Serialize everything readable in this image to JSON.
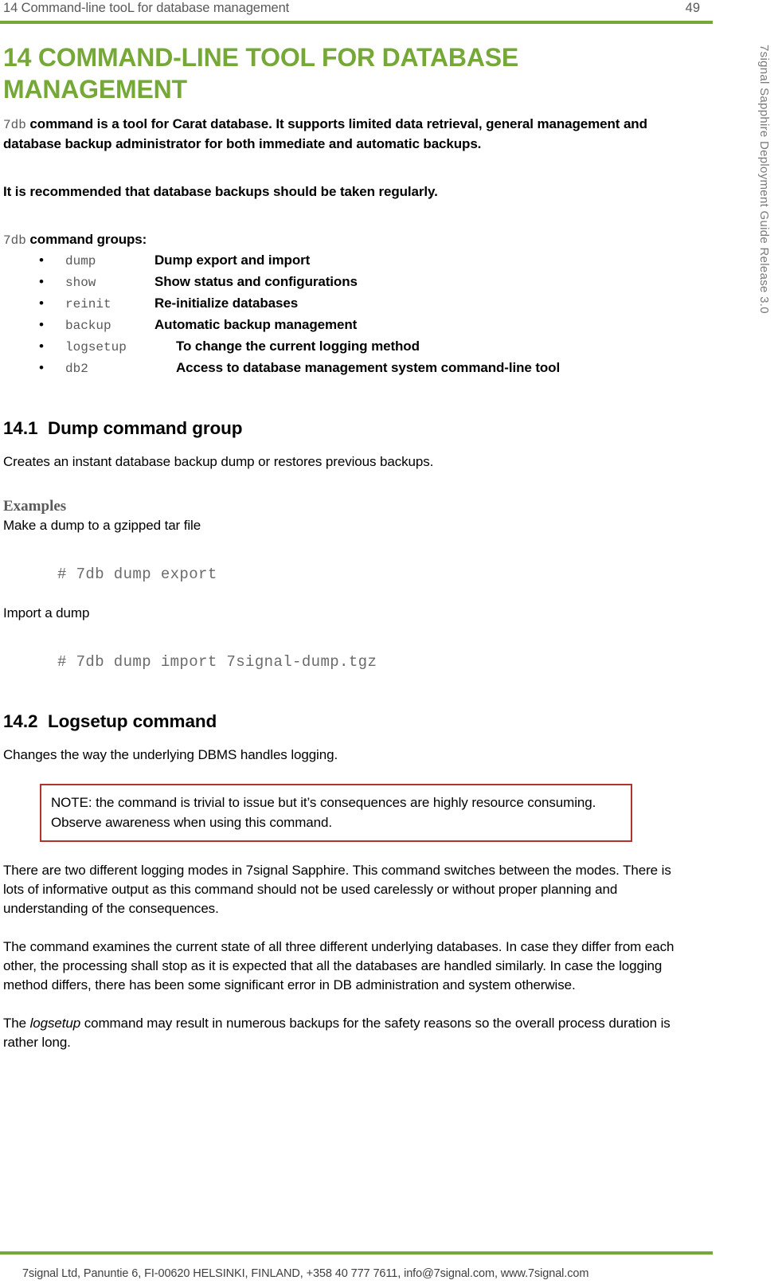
{
  "header": {
    "title": "14 Command-line tooL for database management",
    "page_number": "49"
  },
  "side_title": "7signal Sapphire Deployment Guide Release 3.0",
  "chapter": {
    "heading": "14 COMMAND-LINE TOOL FOR DATABASE MANAGEMENT",
    "intro_cmd": "7db",
    "intro_rest": " command is a tool for Carat database. It supports limited data retrieval, general management and database backup administrator for both immediate and automatic backups.",
    "recommendation": "It is recommended that database backups should be taken regularly.",
    "groups_intro_cmd": "7db",
    "groups_intro_rest": " command groups:"
  },
  "command_groups": [
    {
      "bullet": "•",
      "command": "dump",
      "description": "Dump export and import",
      "indent_desc": false
    },
    {
      "bullet": "•",
      "command": "show",
      "description": "Show status and configurations",
      "indent_desc": false
    },
    {
      "bullet": "•",
      "command": "reinit",
      "description": "Re-initialize databases",
      "indent_desc": false
    },
    {
      "bullet": "•",
      "command": "backup",
      "description": "Automatic backup management",
      "indent_desc": false
    },
    {
      "bullet": "•",
      "command": "logsetup",
      "description": "To change the current logging method",
      "indent_desc": true
    },
    {
      "bullet": "•",
      "command": "db2",
      "description": "Access to database management system command-line tool",
      "indent_desc": true
    }
  ],
  "section_14_1": {
    "number": "14.1",
    "title": "Dump command group",
    "intro": "Creates an instant database backup dump or restores previous backups.",
    "examples_heading": "Examples",
    "example_1_label": "Make a dump  to a gzipped tar file",
    "example_1_code": "# 7db dump export",
    "example_2_label": "Import a dump",
    "example_2_code": "# 7db dump import 7signal-dump.tgz"
  },
  "section_14_2": {
    "number": "14.2",
    "title": "Logsetup command",
    "intro": "Changes the way the underlying DBMS handles logging.",
    "note": "NOTE: the command is trivial to issue but it’s consequences are highly resource consuming. Observe awareness when using this command.",
    "para_1": "There are two different logging modes in 7signal Sapphire. This command switches between the modes. There is lots of informative output as this command should not be used carelessly or without proper planning and understanding of the consequences.",
    "para_2": "The command examines the current state of all three different underlying databases. In case they differ from each other, the processing shall stop as it is expected that all the databases are handled similarly. In case the logging method differs, there has been some significant error in DB administration and system otherwise.",
    "para_3_pre": "The ",
    "para_3_ital": "logsetup",
    "para_3_post": " command may result in numerous backups for the safety reasons so the overall process duration is rather long."
  },
  "footer": {
    "text": "7signal Ltd, Panuntie 6, FI-00620 HELSINKI, FINLAND, +358 40 777 7611, info@7signal.com, www.7signal.com"
  },
  "colors": {
    "accent_green": "#76A838",
    "note_border": "#B0342B",
    "mono_gray": "#595959",
    "header_gray": "#595959"
  }
}
